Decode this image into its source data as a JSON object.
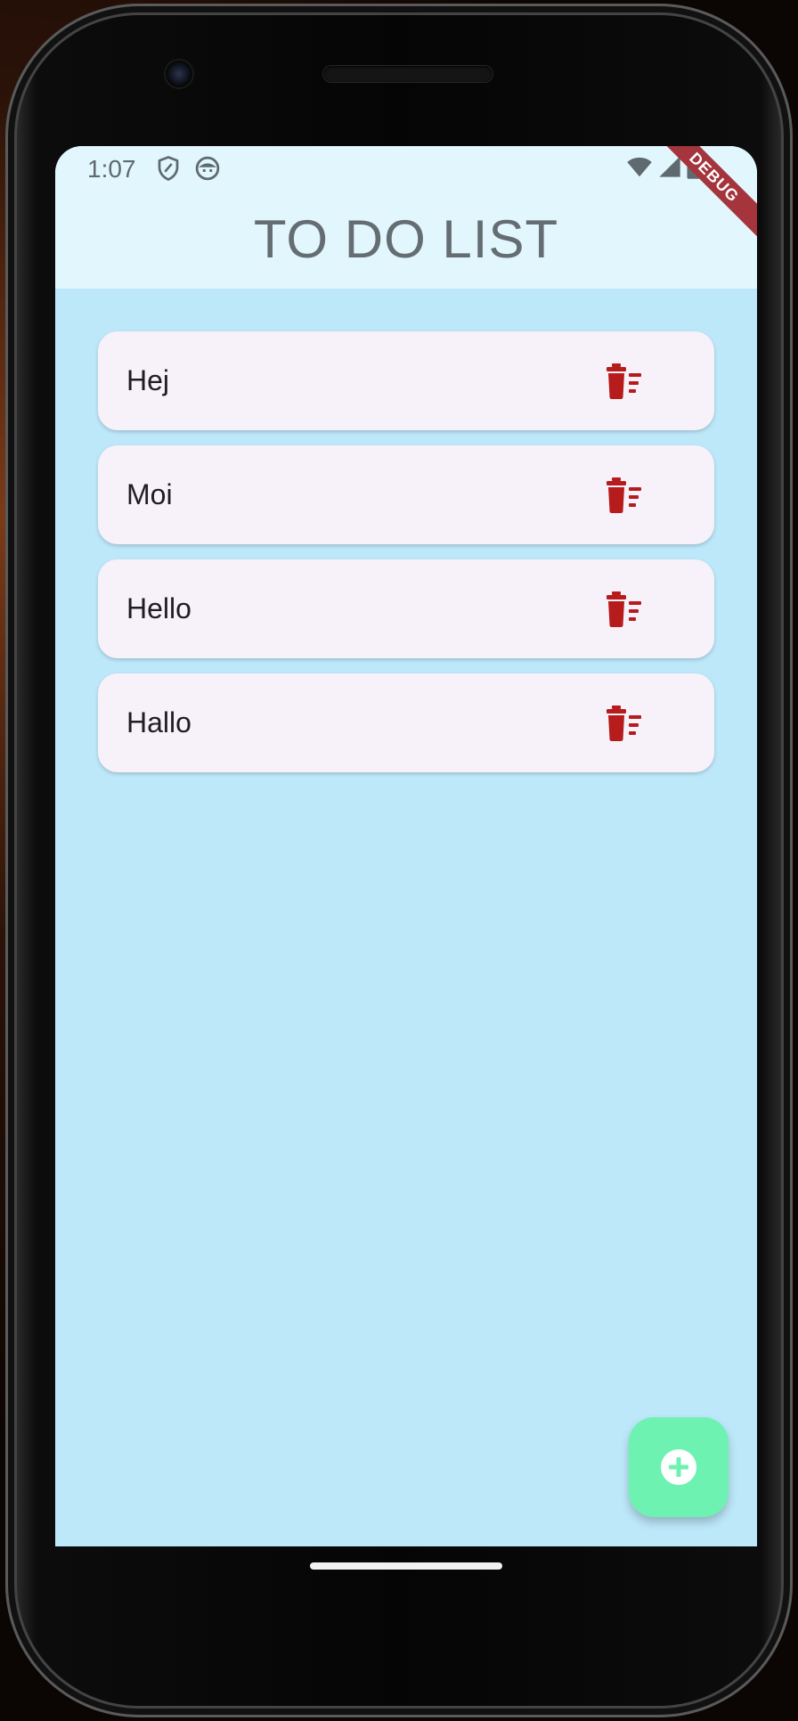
{
  "status_bar": {
    "time": "1:07",
    "icons": [
      "shield-icon",
      "android-face-icon"
    ],
    "right_icons": [
      "wifi-icon",
      "cellular-signal-icon",
      "battery-icon"
    ]
  },
  "app": {
    "title": "TO DO LIST",
    "debug_banner": "DEBUG"
  },
  "todos": [
    {
      "text": "Hej",
      "icon": "delete-sweep-icon"
    },
    {
      "text": "Moi",
      "icon": "delete-sweep-icon"
    },
    {
      "text": "Hello",
      "icon": "delete-sweep-icon"
    },
    {
      "text": "Hallo",
      "icon": "delete-sweep-icon"
    }
  ],
  "fab": {
    "icon": "add-circle-icon"
  },
  "colors": {
    "app_bar": "#e2f6fd",
    "background": "#bde8fa",
    "card": "#f7f1fa",
    "delete_icon": "#b71c1c",
    "fab": "#6ef2b2",
    "debug_banner": "#a5343c"
  }
}
